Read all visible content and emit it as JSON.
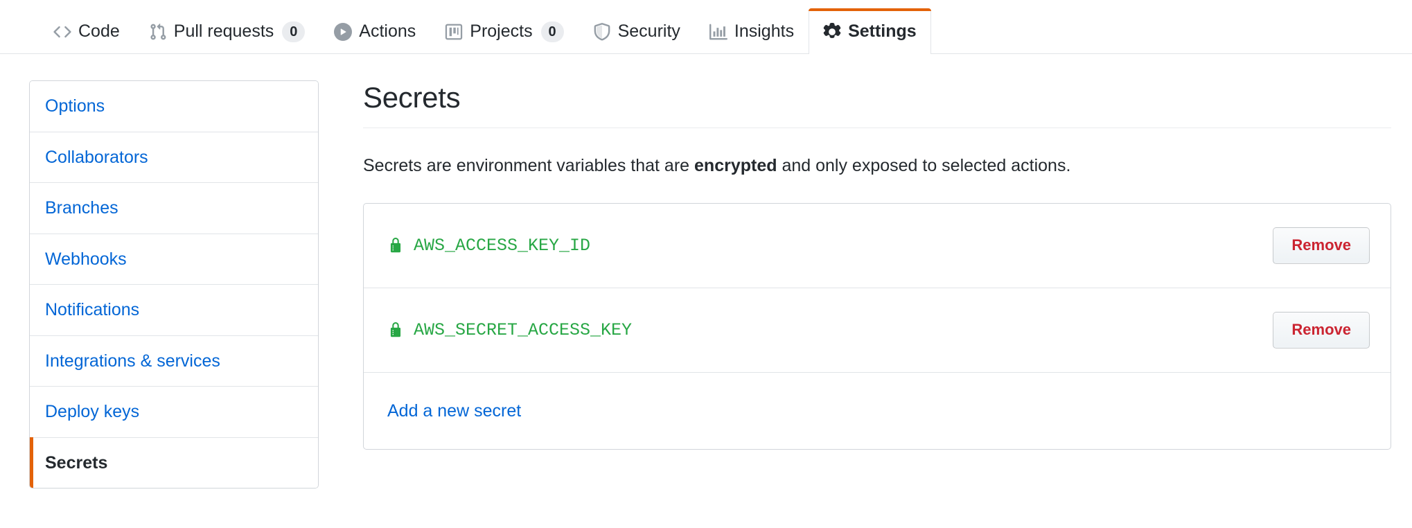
{
  "tabs": [
    {
      "label": "Code",
      "icon": "code-icon",
      "count": null,
      "selected": false
    },
    {
      "label": "Pull requests",
      "icon": "git-pull-request-icon",
      "count": "0",
      "selected": false
    },
    {
      "label": "Actions",
      "icon": "play-icon",
      "count": null,
      "selected": false
    },
    {
      "label": "Projects",
      "icon": "project-board-icon",
      "count": "0",
      "selected": false
    },
    {
      "label": "Security",
      "icon": "shield-icon",
      "count": null,
      "selected": false
    },
    {
      "label": "Insights",
      "icon": "graph-icon",
      "count": null,
      "selected": false
    },
    {
      "label": "Settings",
      "icon": "gear-icon",
      "count": null,
      "selected": true
    }
  ],
  "sidebar": {
    "items": [
      {
        "label": "Options",
        "selected": false
      },
      {
        "label": "Collaborators",
        "selected": false
      },
      {
        "label": "Branches",
        "selected": false
      },
      {
        "label": "Webhooks",
        "selected": false
      },
      {
        "label": "Notifications",
        "selected": false
      },
      {
        "label": "Integrations & services",
        "selected": false
      },
      {
        "label": "Deploy keys",
        "selected": false
      },
      {
        "label": "Secrets",
        "selected": true
      }
    ]
  },
  "main": {
    "title": "Secrets",
    "description_before": "Secrets are environment variables that are ",
    "description_bold": "encrypted",
    "description_after": " and only exposed to selected actions.",
    "secrets": [
      {
        "name": "AWS_ACCESS_KEY_ID",
        "remove_label": "Remove",
        "icon": "lock-icon"
      },
      {
        "name": "AWS_SECRET_ACCESS_KEY",
        "remove_label": "Remove",
        "icon": "lock-icon"
      }
    ],
    "add_secret_label": "Add a new secret"
  },
  "colors": {
    "accent_orange": "#e36209",
    "link_blue": "#0366d6",
    "secret_green": "#28a745",
    "danger_red": "#cb2431",
    "text": "#24292e",
    "border": "#d1d5da"
  }
}
